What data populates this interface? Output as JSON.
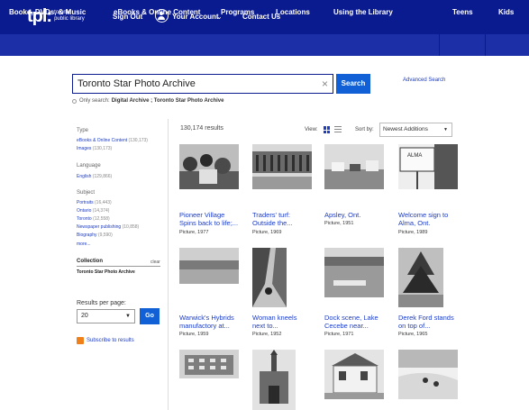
{
  "header": {
    "logo_main": "tpl:",
    "logo_sub_1": "toronto",
    "logo_sub_2": "public library",
    "sign_out": "Sign Out",
    "your_account": "Your Account",
    "contact_us": "Contact Us"
  },
  "nav": {
    "items": [
      "Books, DVDs, & Music",
      "eBooks & Online Content",
      "Programs",
      "Locations",
      "Using the Library",
      "Teens",
      "Kids"
    ]
  },
  "search": {
    "value": "Toronto Star Photo Archive",
    "button": "Search",
    "advanced": "Advanced Search",
    "only_search_label": "Only search:",
    "only_search_value": "Digital Archive ; Toronto Star Photo Archive"
  },
  "sidebar": {
    "type_heading": "Type",
    "type_items": [
      {
        "label": "eBooks & Online Content",
        "count": "(130,173)"
      },
      {
        "label": "Images",
        "count": "(130,173)"
      }
    ],
    "language_heading": "Language",
    "language_items": [
      {
        "label": "English",
        "count": "(129,866)"
      }
    ],
    "subject_heading": "Subject",
    "subject_items": [
      {
        "label": "Portraits",
        "count": "(16,443)"
      },
      {
        "label": "Ontario",
        "count": "(14,374)"
      },
      {
        "label": "Toronto",
        "count": "(12,558)"
      },
      {
        "label": "Newspaper publishing",
        "count": "(10,858)"
      },
      {
        "label": "Biography",
        "count": "(9,590)"
      }
    ],
    "more": "more...",
    "collection_heading": "Collection",
    "collection_clear": "clear",
    "collection_value": "Toronto Star Photo Archive",
    "rpp_label": "Results per page:",
    "rpp_value": "20",
    "go": "Go",
    "subscribe": "Subscribe to results"
  },
  "results": {
    "count": "130,174 results",
    "view_label": "View:",
    "sort_label": "Sort by:",
    "sort_value": "Newest Additions",
    "items": [
      {
        "title_1": "Pioneer Village",
        "title_2": "Spins back to life;...",
        "meta": "Picture, 1977"
      },
      {
        "title_1": "Traders' turf:",
        "title_2": "Outside the...",
        "meta": "Picture, 1969"
      },
      {
        "title_1": "Apsley, Ont.",
        "title_2": "",
        "meta": "Picture, 1951"
      },
      {
        "title_1": "Welcome sign to",
        "title_2": "Alma, Ont.",
        "meta": "Picture, 1989"
      },
      {
        "title_1": "Warwick's Hybrids",
        "title_2": "manufactory at...",
        "meta": "Picture, 1959"
      },
      {
        "title_1": "Woman kneels",
        "title_2": "next to...",
        "meta": "Picture, 1952"
      },
      {
        "title_1": "Dock scene, Lake",
        "title_2": "Cecebe near...",
        "meta": "Picture, 1971"
      },
      {
        "title_1": "Derek Ford stands",
        "title_2": "on top of...",
        "meta": "Picture, 1965"
      },
      {
        "title_1": "",
        "title_2": "",
        "meta": ""
      },
      {
        "title_1": "",
        "title_2": "",
        "meta": ""
      },
      {
        "title_1": "",
        "title_2": "",
        "meta": ""
      },
      {
        "title_1": "",
        "title_2": "",
        "meta": ""
      }
    ]
  },
  "colors": {
    "topbar": "#0a1a8f",
    "navbar": "#1c2fa6",
    "button": "#1160d6",
    "link": "#1c3cc4",
    "rss": "#f0801a"
  }
}
